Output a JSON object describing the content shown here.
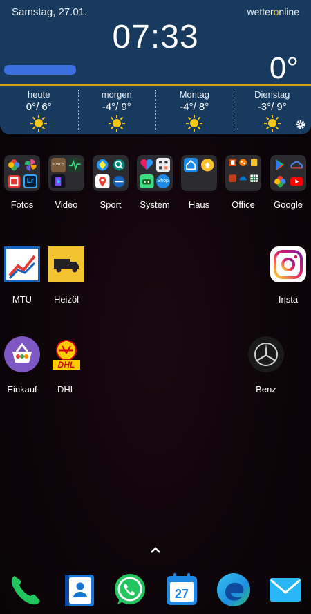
{
  "widget": {
    "date": "Samstag, 27.01.",
    "brand_a": "wetter",
    "brand_o": "o",
    "brand_b": "nline",
    "time": "07:33",
    "current_temp": "0°",
    "forecast": [
      {
        "day": "heute",
        "temp": "0°/ 6°"
      },
      {
        "day": "morgen",
        "temp": "-4°/ 9°"
      },
      {
        "day": "Montag",
        "temp": "-4°/ 8°"
      },
      {
        "day": "Dienstag",
        "temp": "-3°/ 9°"
      }
    ]
  },
  "apps": {
    "row1": [
      "Fotos",
      "Video",
      "Sport",
      "System",
      "Haus",
      "Office",
      "Google"
    ],
    "row2": [
      "MTU",
      "Heizöl",
      "Insta"
    ],
    "row3": [
      "Einkauf",
      "DHL",
      "Benz"
    ]
  },
  "folder_text": {
    "sonos": "SONOS",
    "lr": "Lr",
    "shop": "Shop",
    "calendar_day": "27"
  },
  "colors": {
    "widget_bg": "#173a5e",
    "widget_accent": "#d7a21b",
    "sun": "#f5c518"
  }
}
